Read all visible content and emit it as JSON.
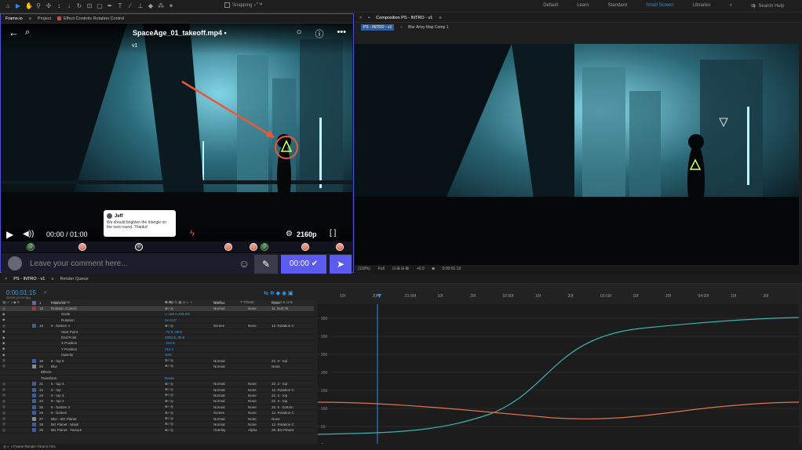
{
  "topbar": {
    "snapping_label": "Snapping",
    "workspaces": [
      "Default",
      "Learn",
      "Standard",
      "Small Screen",
      "Libraries"
    ],
    "active_workspace": "Small Screen",
    "search_placeholder": "Search Help"
  },
  "left_panel": {
    "tabs": [
      "Frame.io",
      "Project",
      "Effect Controls Rotation Control"
    ],
    "frameio": {
      "title": "SpaceAge_01_takeoff.mp4 •",
      "version": "v1",
      "time": "00:00 / 01:00",
      "resolution": "2160p",
      "progress": 0.39,
      "comment_author": "Jeff",
      "comment_text": "We should brighten the triangle on the next round. Thanks!",
      "comment_placeholder": "Leave your comment here...",
      "timecode": "00:00",
      "marker_icons": [
        "@",
        "@",
        "©",
        "@",
        "@",
        "@",
        "@",
        "@"
      ]
    }
  },
  "right_panel": {
    "tab": "Composition PS - INTRO - v1",
    "crumbs": [
      "PS - INTRO - v1",
      "Blur Artsy Map Comp 1"
    ],
    "footer": [
      "(118%)",
      "Full",
      "+0.0",
      "0:00:01:13"
    ]
  },
  "timeline": {
    "tabs": [
      "PS - INTRO - v1",
      "Render Queue"
    ],
    "timecode": "0:00:01:15",
    "timecode_sub": "00039 (24.00 fps)",
    "headers": [
      "Layer Name",
      "Mode",
      "T TrkMat",
      "Parent & Link"
    ],
    "ruler_marks": [
      "10f",
      "20f",
      "01:00f",
      "10f",
      "20f",
      "02:00f",
      "10f",
      "20f",
      "03:00f",
      "10f",
      "20f",
      "04:00f",
      "10f",
      "20f"
    ],
    "y_labels": [
      "350",
      "300",
      "250",
      "200",
      "150",
      "100",
      "50",
      "0"
    ],
    "rows": [
      {
        "num": "1",
        "name": "Frame.io",
        "mode": "Normal",
        "trk": "",
        "parent": "None",
        "color": "#6a6a9e",
        "kind": "layer"
      },
      {
        "num": "13",
        "name": "Rotation Control",
        "mode": "Normal",
        "trk": "None",
        "parent": "11. Null 75",
        "color": "#a33",
        "kind": "layer",
        "sel": true
      },
      {
        "num": "",
        "name": "Scale",
        "mode": "",
        "trk": "",
        "parent": "",
        "value": "∞ 100.0,100.0%",
        "kind": "prop"
      },
      {
        "num": "",
        "name": "Rotation",
        "mode": "",
        "trk": "",
        "parent": "",
        "value": "0x+0.0°",
        "kind": "prop"
      },
      {
        "num": "18",
        "name": "6 - bottom 4",
        "mode": "Screen",
        "trk": "None",
        "parent": "12. Rotation C",
        "color": "#3a5fa8",
        "kind": "layer"
      },
      {
        "num": "",
        "name": "Start Point",
        "mode": "",
        "trk": "",
        "parent": "",
        "value": "-72.0,-38.8",
        "kind": "prop"
      },
      {
        "num": "",
        "name": "End Point",
        "mode": "",
        "trk": "",
        "parent": "",
        "value": "2094.8,-38.8",
        "kind": "prop"
      },
      {
        "num": "",
        "name": "X Position",
        "mode": "",
        "trk": "",
        "parent": "",
        "value": "-222.8",
        "kind": "prop"
      },
      {
        "num": "",
        "name": "Y Position",
        "mode": "",
        "trk": "",
        "parent": "",
        "value": "214.1",
        "kind": "prop"
      },
      {
        "num": "",
        "name": "Opacity",
        "mode": "",
        "trk": "",
        "parent": "",
        "value": "40%",
        "kind": "prop"
      },
      {
        "num": "19",
        "name": "5 - top 5",
        "mode": "Normal",
        "trk": "",
        "parent": "22. 3 - top",
        "color": "#3a5fa8",
        "kind": "layer"
      },
      {
        "num": "20",
        "name": "Blur",
        "mode": "Normal",
        "trk": "",
        "parent": "None",
        "color": "#888",
        "kind": "layer"
      },
      {
        "num": "",
        "name": "Effects",
        "mode": "",
        "trk": "",
        "parent": "",
        "kind": "group"
      },
      {
        "num": "",
        "name": "Transform",
        "mode": "",
        "trk": "",
        "parent": "",
        "value": "Reset",
        "kind": "group"
      },
      {
        "num": "21",
        "name": "5 - top 4",
        "mode": "Normal",
        "trk": "None",
        "parent": "22. 3 - top",
        "color": "#3a5fa8",
        "kind": "layer"
      },
      {
        "num": "22",
        "name": "5 - top",
        "mode": "Normal",
        "trk": "None",
        "parent": "12. Rotation C",
        "color": "#3a5fa8",
        "kind": "layer"
      },
      {
        "num": "23",
        "name": "5 - top 3",
        "mode": "Normal",
        "trk": "None",
        "parent": "22. 3 - top",
        "color": "#3a5fa8",
        "kind": "layer"
      },
      {
        "num": "24",
        "name": "5 - top 2",
        "mode": "Normal",
        "trk": "None",
        "parent": "22. 3 - top",
        "color": "#3a5fa8",
        "kind": "layer"
      },
      {
        "num": "25",
        "name": "6 - bottom 3",
        "mode": "Normal",
        "trk": "None",
        "parent": "26. 6 - bottom",
        "color": "#3a5fa8",
        "kind": "layer"
      },
      {
        "num": "26",
        "name": "6 - bottom",
        "mode": "Screen",
        "trk": "None",
        "parent": "12. Rotation C",
        "color": "#3a5fa8",
        "kind": "layer"
      },
      {
        "num": "27",
        "name": "Blur - BG Planet",
        "mode": "Normal",
        "trk": "None",
        "parent": "None",
        "color": "#888",
        "kind": "layer"
      },
      {
        "num": "28",
        "name": "BG Planet - Mask",
        "mode": "Normal",
        "trk": "None",
        "parent": "12. Rotation C",
        "color": "#3a5fa8",
        "kind": "layer"
      },
      {
        "num": "29",
        "name": "BG Planet - Texture",
        "mode": "Overlay",
        "trk": "Alpha",
        "parent": "28. BG Planet",
        "color": "#3a5fa8",
        "kind": "layer"
      }
    ],
    "footer_label": "Frame Render Time 6.7ms",
    "colors": {
      "curve_cyan": "#3bb3b0",
      "curve_orange": "#e2734a",
      "accent": "#2d8ceb"
    }
  }
}
